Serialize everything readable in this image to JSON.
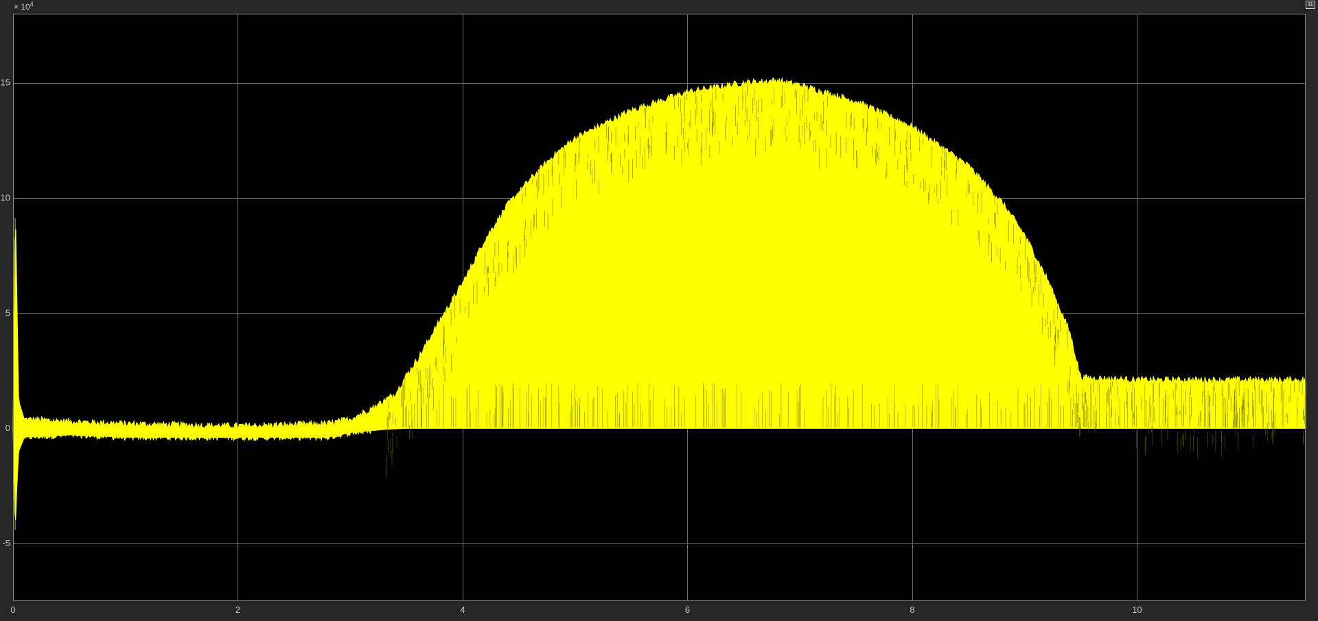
{
  "window": {
    "undock_icon": "undock-icon",
    "undock_glyph": "⧉"
  },
  "colors": {
    "background": "#000000",
    "frame": "#262626",
    "grid": "#6e6e6e",
    "axis_text": "#c8c8c8",
    "signal": "#ffff00"
  },
  "chart_data": {
    "type": "line",
    "title": "",
    "xlabel": "",
    "ylabel": "",
    "xlim": [
      0,
      11.5
    ],
    "ylim": [
      -7.5,
      18
    ],
    "y_exponent_label": "× 10",
    "y_exponent_power": "4",
    "grid": true,
    "xticks": [
      0,
      2,
      4,
      6,
      8,
      10
    ],
    "xtick_labels": [
      "0",
      "2",
      "4",
      "6",
      "8",
      "10"
    ],
    "yticks": [
      -5,
      0,
      5,
      10,
      15
    ],
    "ytick_labels": [
      "-5",
      "0",
      "5",
      "10",
      "15"
    ],
    "series": [
      {
        "color": "#ffff00",
        "description_points": {
          "upper_envelope_x": [
            0,
            0.02,
            0.05,
            0.1,
            0.5,
            1.0,
            2.0,
            2.8,
            3.0,
            3.2,
            3.4,
            3.5,
            3.6,
            3.8,
            4.0,
            4.2,
            4.4,
            4.6,
            4.8,
            5.0,
            5.5,
            6.0,
            6.5,
            6.8,
            7.0,
            7.5,
            8.0,
            8.5,
            8.8,
            9.0,
            9.2,
            9.4,
            9.5,
            10.0,
            11.0,
            11.5
          ],
          "upper_envelope_y": [
            0,
            10,
            1.2,
            0.4,
            0.3,
            0.2,
            0.1,
            0.2,
            0.4,
            0.9,
            1.5,
            2.3,
            3.0,
            4.7,
            6.3,
            8.2,
            9.7,
            10.8,
            11.8,
            12.6,
            13.8,
            14.6,
            15.0,
            15.1,
            14.9,
            14.2,
            13.1,
            11.4,
            9.8,
            8.4,
            6.5,
            4.2,
            2.2,
            2.1,
            2.1,
            2.1
          ],
          "lower_envelope_x": [
            0,
            0.02,
            0.03,
            0.05,
            0.1,
            0.5,
            1.0,
            2.0,
            2.8,
            3.0,
            3.3,
            3.5,
            11.5
          ],
          "lower_envelope_y": [
            0,
            -4.6,
            -3.0,
            -1.0,
            -0.4,
            -0.3,
            -0.4,
            -0.4,
            -0.4,
            -0.2,
            -0.05,
            0,
            0
          ]
        }
      }
    ]
  }
}
